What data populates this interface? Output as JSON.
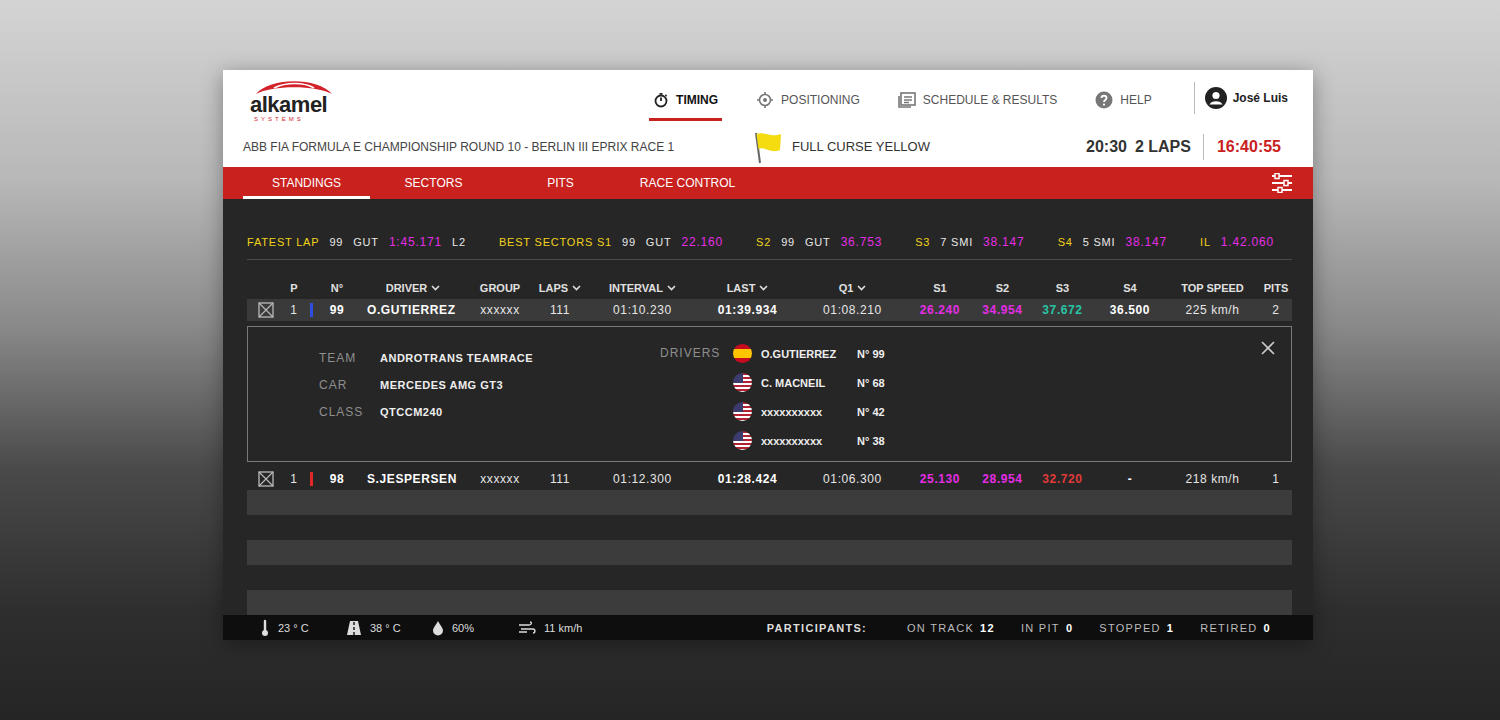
{
  "header": {
    "logo": {
      "name": "alkamel",
      "tagline": "SYSTEMS"
    },
    "nav": [
      {
        "label": "TIMING",
        "kind": "stopwatch",
        "selected": true
      },
      {
        "label": "POSITIONING",
        "kind": "target",
        "selected": false
      },
      {
        "label": "SCHEDULE & RESULTS",
        "kind": "book",
        "selected": false
      },
      {
        "label": "HELP",
        "kind": "help",
        "selected": false
      }
    ],
    "user": "José Luis",
    "event": "ABB FIA FORMULA E CHAMPIONSHIP ROUND 10 - BERLIN III EPRIX RACE 1",
    "race_status": "FULL CURSE YELLOW",
    "remaining": "20:30",
    "laps": "2 LAPS",
    "clock": "16:40:55"
  },
  "tabs": [
    {
      "label": "STANDINGS",
      "selected": true
    },
    {
      "label": "SECTORS",
      "selected": false
    },
    {
      "label": "PITS",
      "selected": false
    },
    {
      "label": "RACE CONTROL",
      "selected": false
    }
  ],
  "best": [
    {
      "items": [
        {
          "kind": "label",
          "text": "FATEST LAP"
        },
        {
          "kind": "plain",
          "text": "99"
        },
        {
          "kind": "plain",
          "text": "GUT"
        },
        {
          "kind": "value",
          "text": "1:45.171"
        },
        {
          "kind": "plain",
          "text": "L2"
        }
      ]
    },
    {
      "items": [
        {
          "kind": "label",
          "text": "BEST SECTORS S1"
        },
        {
          "kind": "plain",
          "text": "99"
        },
        {
          "kind": "plain",
          "text": "GUT"
        },
        {
          "kind": "value",
          "text": "22.160"
        }
      ]
    },
    {
      "items": [
        {
          "kind": "label",
          "text": "S2"
        },
        {
          "kind": "plain",
          "text": "99"
        },
        {
          "kind": "plain",
          "text": "GUT"
        },
        {
          "kind": "value",
          "text": "36.753"
        }
      ]
    },
    {
      "items": [
        {
          "kind": "label",
          "text": "S3"
        },
        {
          "kind": "plain",
          "text": "7 SMI"
        },
        {
          "kind": "value",
          "text": "38.147"
        }
      ]
    },
    {
      "items": [
        {
          "kind": "label",
          "text": "S4"
        },
        {
          "kind": "plain",
          "text": "5 SMI"
        },
        {
          "kind": "value",
          "text": "38.147"
        }
      ]
    },
    {
      "items": [
        {
          "kind": "label",
          "text": "IL"
        },
        {
          "kind": "value",
          "text": "1.42.060"
        }
      ]
    }
  ],
  "table": {
    "columns": [
      {
        "label": "P",
        "sortable": false
      },
      {
        "label": "N°",
        "sortable": false
      },
      {
        "label": "DRIVER",
        "sortable": true
      },
      {
        "label": "GROUP",
        "sortable": false
      },
      {
        "label": "LAPS",
        "sortable": true
      },
      {
        "label": "INTERVAL",
        "sortable": true
      },
      {
        "label": "LAST",
        "sortable": true
      },
      {
        "label": "Q1",
        "sortable": true
      },
      {
        "label": "S1",
        "sortable": false
      },
      {
        "label": "S2",
        "sortable": false
      },
      {
        "label": "S3",
        "sortable": false
      },
      {
        "label": "S4",
        "sortable": false
      },
      {
        "label": "TOP SPEED",
        "sortable": false
      },
      {
        "label": "PITS",
        "sortable": false
      }
    ],
    "rows": [
      {
        "position": "1",
        "number": "99",
        "color": "#2f4fe0",
        "driver": "O.GUTIERREZ",
        "group": "xxxxxx",
        "laps": "111",
        "interval": "01:10.230",
        "last": "01:39.934",
        "q1": "01:08.210",
        "sectors": [
          {
            "value": "26.240",
            "color": "#e52de5"
          },
          {
            "value": "34.954",
            "color": "#e52de5"
          },
          {
            "value": "37.672",
            "color": "#27c4a4"
          },
          {
            "value": "36.500",
            "color": "#ffffff"
          }
        ],
        "top_speed": "225 km/h",
        "pits": "2",
        "expanded": true,
        "details": {
          "fields": [
            {
              "label": "TEAM",
              "value": "ANDROTRANS TEAMRACE"
            },
            {
              "label": "CAR",
              "value": "MERCEDES AMG GT3"
            },
            {
              "label": "CLASS",
              "value": "QTCCM240"
            }
          ],
          "drivers_label": "DRIVERS",
          "drivers": [
            {
              "kind": "es",
              "name": "O.GUTIERREZ",
              "number": "N° 99"
            },
            {
              "kind": "us",
              "name": "C. MACNEIL",
              "number": "N° 68"
            },
            {
              "kind": "us",
              "name": "xxxxxxxxxx",
              "number": "N° 42"
            },
            {
              "kind": "us",
              "name": "xxxxxxxxxx",
              "number": "N° 38"
            }
          ]
        }
      },
      {
        "position": "1",
        "number": "98",
        "color": "#e02828",
        "driver": "S.JESPERSEN",
        "group": "xxxxxx",
        "laps": "111",
        "interval": "01:12.300",
        "last": "01:28.424",
        "q1": "01:06.300",
        "sectors": [
          {
            "value": "25.130",
            "color": "#e52de5"
          },
          {
            "value": "28.954",
            "color": "#e52de5"
          },
          {
            "value": "32.720",
            "color": "#e03a3a"
          },
          {
            "value": "-",
            "color": "#ffffff"
          }
        ],
        "top_speed": "218 km/h",
        "pits": "1",
        "expanded": false
      }
    ]
  },
  "status_bar": {
    "weather": [
      {
        "kind": "air",
        "text": "23 ° C"
      },
      {
        "kind": "track",
        "text": "38 ° C"
      },
      {
        "kind": "humidity",
        "text": "60%"
      },
      {
        "kind": "wind",
        "text": "11 km/h"
      }
    ],
    "participants_label": "PARTICIPANTS:",
    "counts": [
      {
        "label": "ON TRACK",
        "value": "12"
      },
      {
        "label": "IN PIT",
        "value": "0"
      },
      {
        "label": "STOPPED",
        "value": "1"
      },
      {
        "label": "RETIRED",
        "value": "0"
      }
    ]
  }
}
